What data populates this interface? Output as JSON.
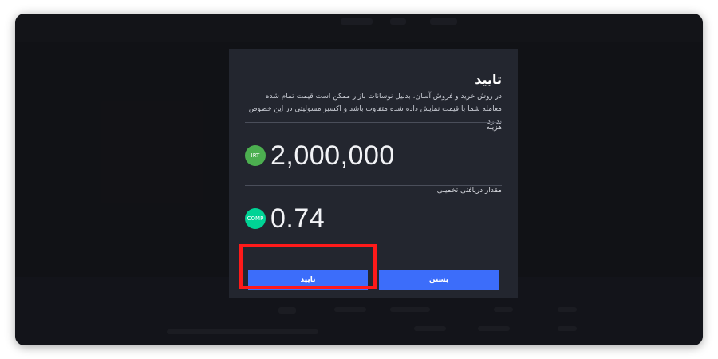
{
  "modal": {
    "title": "تایید",
    "description": "در روش خرید و فروش آسان، بدلیل نوسانات بازار ممکن است قیمت تمام شده معامله شما با قیمت نمایش داده شده متفاوت باشد و اکسیر مسولیتی در این خصوص ندارد",
    "cost_label": "هزینه",
    "cost_amount": "2,000,000",
    "cost_currency": "IRT",
    "estimate_label": "مقدار دریافتی تخمینی",
    "estimate_amount": "0.74",
    "estimate_currency": "COMP",
    "confirm_label": "تایید",
    "close_label": "بستن"
  },
  "colors": {
    "modal_bg": "#23262f",
    "button_blue": "#3c6dfa",
    "irt_green": "#4caf50",
    "comp_green": "#00d395",
    "highlight_red": "#ff1a1a"
  }
}
